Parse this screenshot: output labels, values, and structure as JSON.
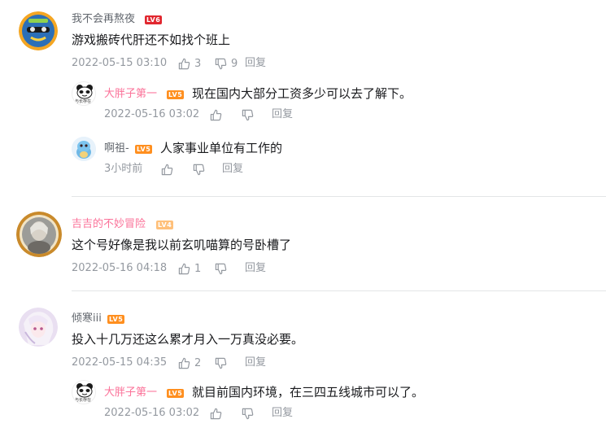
{
  "comments": [
    {
      "username": "我不会再熬夜",
      "level": "LV6",
      "content": "游戏搬砖代肝还不如找个班上",
      "time": "2022-05-15 03:10",
      "likes": "3",
      "dislikes": "9",
      "reply": "回复"
    },
    {
      "username": "吉吉的不妙冒险",
      "level": "LV4",
      "content": "这个号好像是我以前玄叽喵算的号卧槽了",
      "time": "2022-05-16 04:18",
      "likes": "1",
      "reply": "回复"
    },
    {
      "username": "倾寒iii",
      "level": "LV5",
      "content": "投入十几万还这么累才月入一万真没必要。",
      "time": "2022-05-15 04:35",
      "likes": "2",
      "reply": "回复"
    }
  ],
  "replies": [
    {
      "username": "大胖子第一",
      "level": "LV5",
      "content": "现在国内大部分工资多少可以去了解下。",
      "time": "2022-05-16 03:02",
      "reply": "回复",
      "avatar_caption": "与长存在"
    },
    {
      "username": "啊祖-",
      "level": "LV5",
      "content": "人家事业单位有工作的",
      "time": "3小时前",
      "reply": "回复"
    },
    {
      "username": "大胖子第一",
      "level": "LV5",
      "content": "就目前国内环境，在三四五线城市可以了。",
      "time": "2022-05-16 03:02",
      "reply": "回复",
      "avatar_caption": "与长存在"
    }
  ],
  "colors": {
    "vip_name": "#fb7299",
    "normal_name": "#61666d",
    "meta": "#9499a0",
    "divider": "#e3e5e7",
    "lv_red": "#e1272f",
    "lv_orange": "#ff8f1f",
    "lv_yellow": "#ffc07a"
  },
  "icons": [
    "thumbs-up-icon",
    "thumbs-down-icon"
  ]
}
